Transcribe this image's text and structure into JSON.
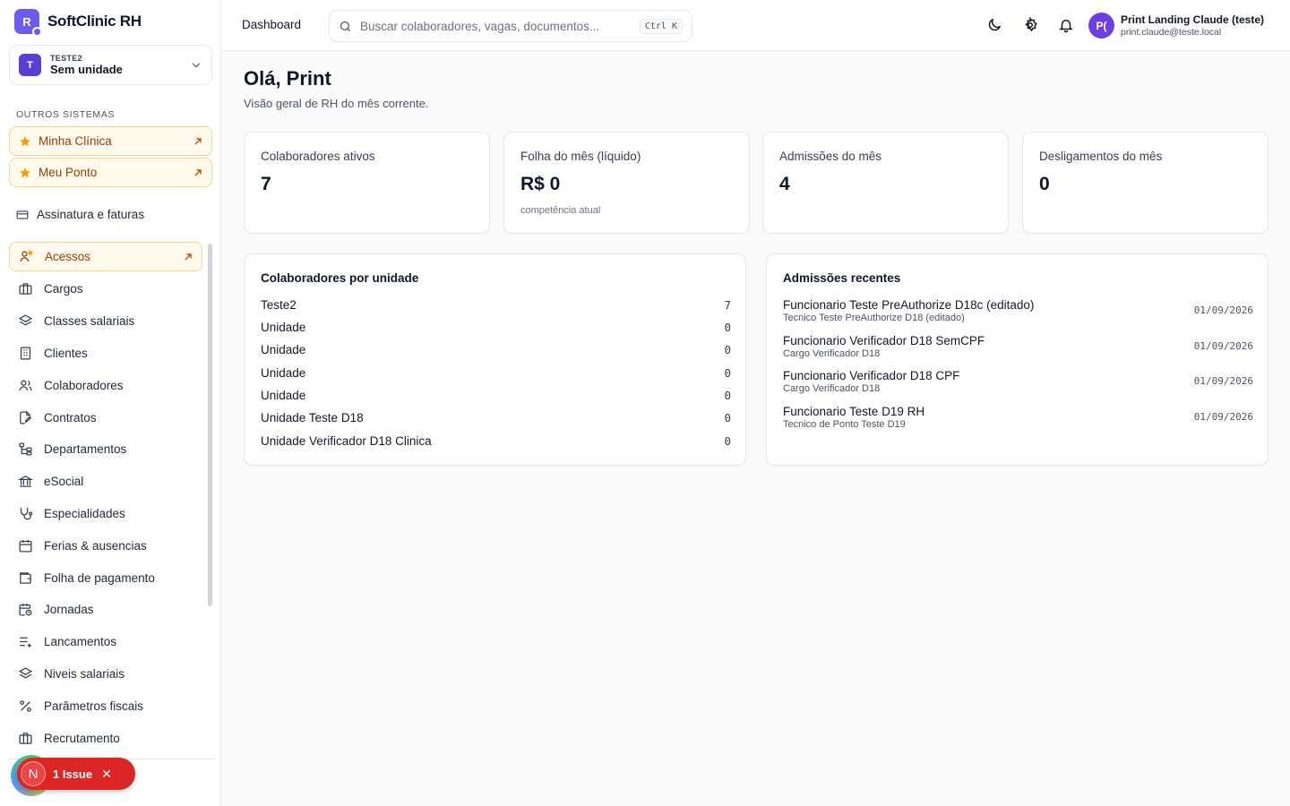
{
  "brand": {
    "logo_letter": "R",
    "name": "SoftClinic RH"
  },
  "unit_selector": {
    "avatar": "T",
    "org": "TESTE2",
    "unit": "Sem unidade"
  },
  "other_systems": {
    "label": "OUTROS SISTEMAS",
    "items": [
      {
        "label": "Minha Clínica",
        "icon": "star-icon"
      },
      {
        "label": "Meu Ponto",
        "icon": "star-icon"
      }
    ]
  },
  "billing": {
    "label": "Assinatura e faturas",
    "icon": "credit-card-icon"
  },
  "nav": {
    "items": [
      {
        "label": "Acessos",
        "icon": "users-star-icon",
        "active": true
      },
      {
        "label": "Cargos",
        "icon": "briefcase-icon"
      },
      {
        "label": "Classes salariais",
        "icon": "layers-icon"
      },
      {
        "label": "Clientes",
        "icon": "building-icon"
      },
      {
        "label": "Colaboradores",
        "icon": "users-icon"
      },
      {
        "label": "Contratos",
        "icon": "file-edit-icon"
      },
      {
        "label": "Departamentos",
        "icon": "org-tree-icon"
      },
      {
        "label": "eSocial",
        "icon": "landmark-icon"
      },
      {
        "label": "Especialidades",
        "icon": "stethoscope-icon"
      },
      {
        "label": "Ferias & ausencias",
        "icon": "calendar-icon"
      },
      {
        "label": "Folha de pagamento",
        "icon": "wallet-icon"
      },
      {
        "label": "Jornadas",
        "icon": "calendar-clock-icon"
      },
      {
        "label": "Lancamentos",
        "icon": "list-plus-icon"
      },
      {
        "label": "Niveis salariais",
        "icon": "layers-icon"
      },
      {
        "label": "Parâmetros fiscais",
        "icon": "percent-icon"
      },
      {
        "label": "Recrutamento",
        "icon": "briefcase-icon"
      }
    ]
  },
  "issue_badge": {
    "letter": "N",
    "label": "1 Issue"
  },
  "topbar": {
    "breadcrumb": "Dashboard",
    "search_placeholder": "Buscar colaboradores, vagas, documentos...",
    "shortcut": "Ctrl K",
    "user": {
      "initials": "P(",
      "name": "Print Landing Claude (teste)",
      "email": "print.claude@teste.local"
    }
  },
  "greeting": {
    "title": "Olá, Print",
    "subtitle": "Visão geral de RH do mês corrente."
  },
  "stats": [
    {
      "label": "Colaboradores ativos",
      "value": "7",
      "foot": ""
    },
    {
      "label": "Folha do mês (líquido)",
      "value": "R$ 0",
      "foot": "competência atual"
    },
    {
      "label": "Admissões do mês",
      "value": "4",
      "foot": ""
    },
    {
      "label": "Desligamentos do mês",
      "value": "0",
      "foot": ""
    }
  ],
  "units_panel": {
    "title": "Colaboradores por unidade",
    "rows": [
      {
        "name": "Teste2",
        "count": "7"
      },
      {
        "name": "Unidade",
        "count": "0"
      },
      {
        "name": "Unidade",
        "count": "0"
      },
      {
        "name": "Unidade",
        "count": "0"
      },
      {
        "name": "Unidade",
        "count": "0"
      },
      {
        "name": "Unidade Teste D18",
        "count": "0"
      },
      {
        "name": "Unidade Verificador D18 Clinica",
        "count": "0"
      }
    ]
  },
  "admissions_panel": {
    "title": "Admissões recentes",
    "rows": [
      {
        "name": "Funcionario Teste PreAuthorize D18c (editado)",
        "role": "Tecnico Teste PreAuthorize D18 (editado)",
        "date": "01/09/2026"
      },
      {
        "name": "Funcionario Verificador D18 SemCPF",
        "role": "Cargo Verificador D18",
        "date": "01/09/2026"
      },
      {
        "name": "Funcionario Verificador D18 CPF",
        "role": "Cargo Verificador D18",
        "date": "01/09/2026"
      },
      {
        "name": "Funcionario Teste D19 RH",
        "role": "Tecnico de Ponto Teste D19",
        "date": "01/09/2026"
      }
    ]
  },
  "colors": {
    "accent": "#6d5ce8",
    "highlight_bg": "#fffaeb",
    "highlight_border": "#fbd38d",
    "highlight_text": "#92400e",
    "issue_red": "#dc2626"
  }
}
